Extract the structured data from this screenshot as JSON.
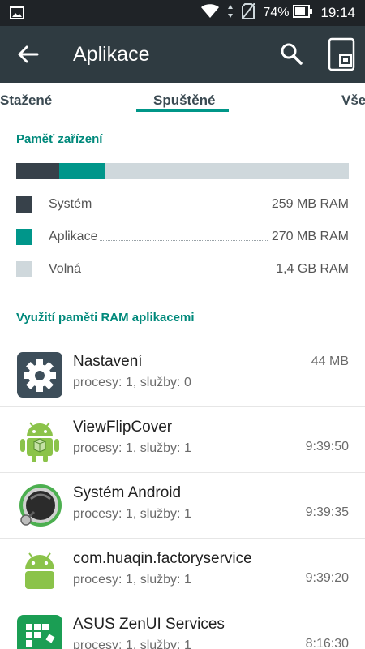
{
  "status_bar": {
    "battery": "74%",
    "time": "19:14",
    "icons": [
      "image-icon",
      "wifi-icon",
      "data-arrows-icon",
      "no-sim-icon",
      "battery-icon"
    ]
  },
  "app_bar": {
    "title": "Aplikace",
    "background": "#2f3b41",
    "icons": [
      "back-arrow-icon",
      "search-icon",
      "memory-card-icon"
    ]
  },
  "tabs": {
    "items": [
      {
        "label": "Stažené"
      },
      {
        "label": "Spuštěné",
        "selected": true
      },
      {
        "label": "Vše"
      }
    ],
    "accent": "#009688"
  },
  "memory": {
    "title": "Paměť zařízení",
    "usage_fraction": {
      "system": 0.13,
      "apps": 0.135,
      "free": 0.735
    },
    "legend": [
      {
        "label": "Systém",
        "value": "259 MB RAM",
        "color": "#37414a"
      },
      {
        "label": "Aplikace",
        "value": "270 MB RAM",
        "color": "#00968a"
      },
      {
        "label": "Volná",
        "value": "1,4 GB RAM",
        "color": "#cfd8dc"
      }
    ]
  },
  "apps_section": {
    "title": "Využití paměti RAM aplikacemi",
    "items": [
      {
        "name": "Nastavení",
        "sub": "procesy: 1, služby: 0",
        "value": "44 MB",
        "icon": "settings-gear-icon"
      },
      {
        "name": "ViewFlipCover",
        "sub": "procesy: 1, služby: 1",
        "value": "9:39:50",
        "icon": "android-robot-icon"
      },
      {
        "name": "Systém Android",
        "sub": "procesy: 1, služby: 1",
        "value": "9:39:35",
        "icon": "android-system-icon"
      },
      {
        "name": "com.huaqin.factoryservice",
        "sub": "procesy: 1, služby: 1",
        "value": "9:39:20",
        "icon": "android-robot-icon"
      },
      {
        "name": "ASUS ZenUI Services",
        "sub": "procesy: 1, služby: 1",
        "value": "8:16:30",
        "icon": "zenui-services-icon"
      }
    ]
  }
}
